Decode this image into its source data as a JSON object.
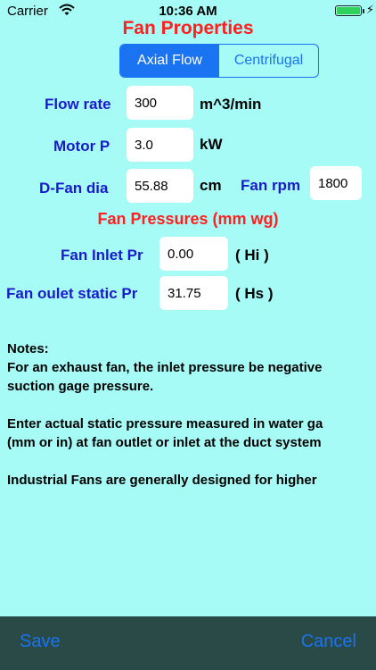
{
  "status_bar": {
    "carrier": "Carrier",
    "time": "10:36 AM"
  },
  "title": "Fan Properties",
  "segmented": {
    "axial": "Axial Flow",
    "centrifugal": "Centrifugal"
  },
  "fields": {
    "flow_rate": {
      "label": "Flow rate",
      "value": "300",
      "unit": "m^3/min"
    },
    "motor_p": {
      "label": "Motor P",
      "value": "3.0",
      "unit": "kW"
    },
    "d_fan_dia": {
      "label": "D-Fan dia",
      "value": "55.88",
      "unit": "cm"
    },
    "fan_rpm": {
      "label": "Fan rpm",
      "value": "1800"
    }
  },
  "pressures": {
    "title": "Fan Pressures (mm wg)",
    "inlet": {
      "label": "Fan Inlet Pr",
      "value": "0.00",
      "unit": "( Hi )"
    },
    "outlet": {
      "label": "Fan oulet static Pr",
      "value": "31.75",
      "unit": "( Hs )"
    }
  },
  "notes": {
    "heading": "Notes:",
    "line1": "For an exhaust fan, the inlet pressure be negative",
    "line2": "suction gage pressure.",
    "line3": "Enter actual static pressure measured in water ga",
    "line4": "(mm or in) at fan outlet or inlet at the duct system",
    "line5": "Industrial Fans are generally designed for higher"
  },
  "bottom": {
    "save": "Save",
    "cancel": "Cancel"
  }
}
